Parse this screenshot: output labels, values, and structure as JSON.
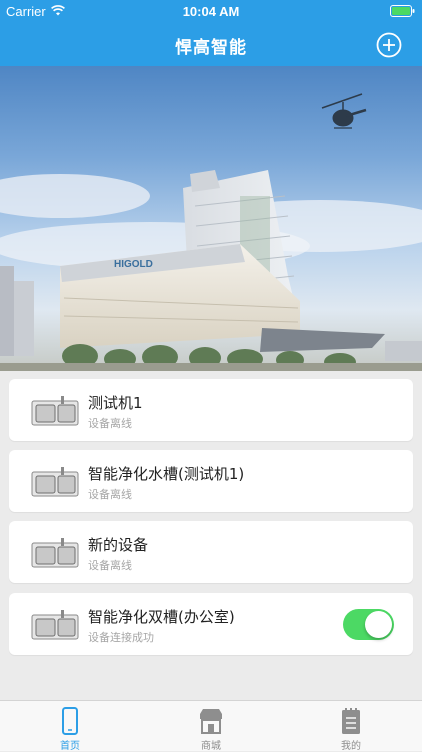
{
  "status_bar": {
    "carrier": "Carrier",
    "time": "10:04 AM"
  },
  "header": {
    "title": "悍高智能",
    "add_icon": "plus-circle-icon"
  },
  "banner": {
    "sign_text": "HIGOLD"
  },
  "devices": [
    {
      "name": "测试机1",
      "status": "设备离线",
      "icon": "sink-icon"
    },
    {
      "name": "智能净化水槽(测试机1)",
      "status": "设备离线",
      "icon": "sink-icon"
    },
    {
      "name": "新的设备",
      "status": "设备离线",
      "icon": "sink-icon"
    },
    {
      "name": "智能净化双槽(办公室)",
      "status": "设备连接成功",
      "icon": "sink-icon",
      "switch_on": true
    }
  ],
  "tabs": [
    {
      "label": "首页",
      "icon": "phone-icon",
      "active": true
    },
    {
      "label": "商城",
      "icon": "store-icon",
      "active": false
    },
    {
      "label": "我的",
      "icon": "notepad-icon",
      "active": false
    }
  ],
  "colors": {
    "header": "#2c9ee6",
    "active_tab": "#2c9ee6",
    "inactive_tab": "#8e8e8e",
    "toggle_on": "#4cd964",
    "background": "#ebebeb"
  }
}
